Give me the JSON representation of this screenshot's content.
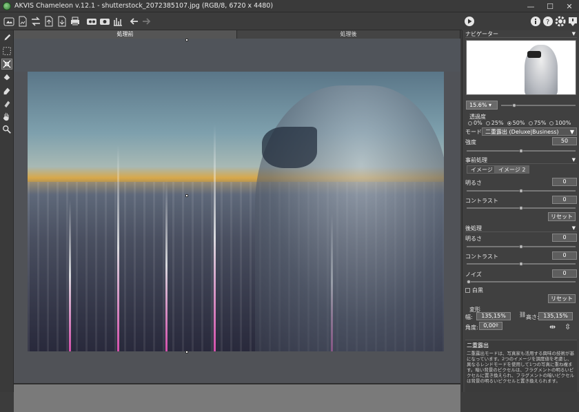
{
  "window": {
    "title": "AKVIS Chameleon v.12.1 - shutterstock_2072385107.jpg (RGB/8, 6720 x 4480)",
    "minimize": "—",
    "maximize": "☐",
    "close": "✕"
  },
  "canvas": {
    "tabs": [
      "処理前",
      "処理後"
    ],
    "active_tab": 0
  },
  "navigator": {
    "title": "ナビゲーター",
    "zoom": "15.6%"
  },
  "opacity": {
    "label": "透過度",
    "options": [
      "0%",
      "25%",
      "50%",
      "75%",
      "100%"
    ],
    "selected": "50%"
  },
  "mode": {
    "label": "モード",
    "value": "二重露出 (Deluxe|Business)"
  },
  "strength": {
    "label": "強度",
    "value": "50",
    "level": 0.5
  },
  "pre": {
    "title": "事前処理",
    "tabs": [
      "イメージ 1",
      "イメージ 2"
    ],
    "active_tab": 1,
    "brightness_label": "明るさ",
    "brightness": "0",
    "contrast_label": "コントラスト",
    "contrast": "0",
    "reset": "リセット"
  },
  "post": {
    "title": "後処理",
    "brightness_label": "明るさ",
    "brightness": "0",
    "contrast_label": "コントラスト",
    "contrast": "0",
    "noise_label": "ノイズ",
    "noise": "0",
    "bw_label": "白黒",
    "reset": "リセット"
  },
  "transform": {
    "title": "変形",
    "width_label": "幅:",
    "width": "135,15%",
    "height_label": "高さ:",
    "height": "135,15%",
    "angle_label": "角度:",
    "angle": "0,00º"
  },
  "help": {
    "title": "二重露出",
    "text": "二重露出モードは、写真家も活用する興味の技術が基になっています。2つのイメージを調度値を考慮し、異なるレンドモードを使用して1つの写真に重ね複ます。暗い背景のピクセルは、フラグメントの明るいピクセルに置き換えられ、フラグメントの暗いピクセルは背景の明るいピクセルと置き換えられます。"
  }
}
